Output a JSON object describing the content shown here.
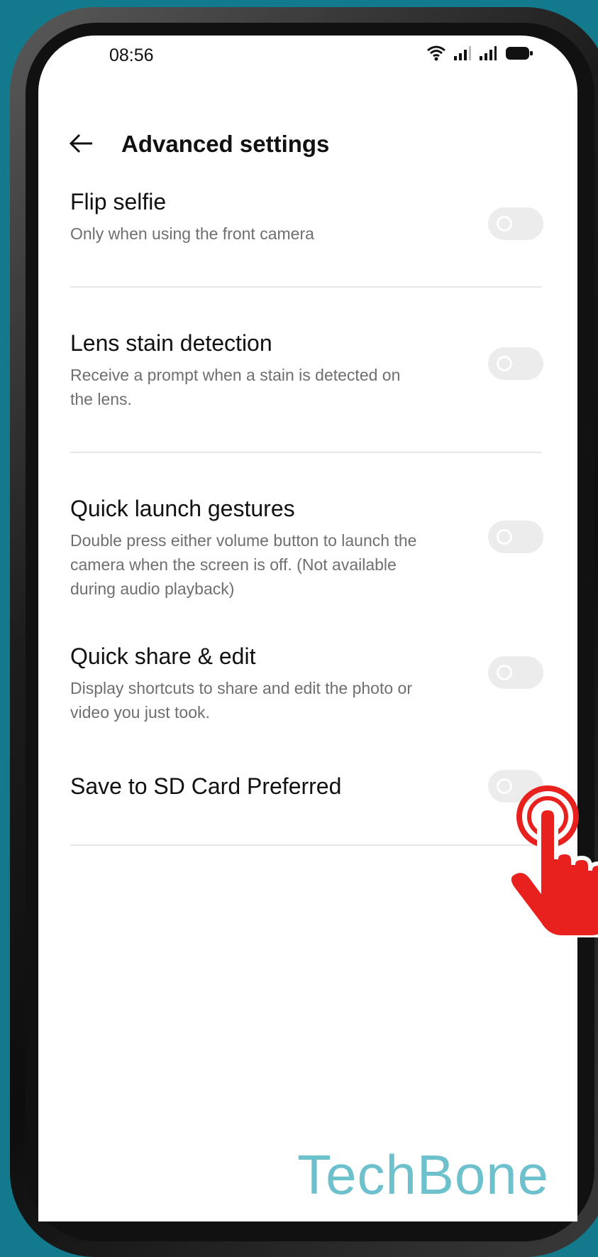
{
  "status_bar": {
    "time": "08:56",
    "icons": [
      "wifi-icon",
      "signal-icon",
      "signal-icon",
      "battery-icon"
    ]
  },
  "header": {
    "back_icon": "arrow-left-icon",
    "title": "Advanced settings"
  },
  "settings": [
    {
      "title": "Flip selfie",
      "description": "Only when using the front camera",
      "enabled": false
    },
    {
      "title": "Lens stain detection",
      "description": "Receive a prompt when a stain is detected on the lens.",
      "enabled": false
    },
    {
      "title": "Quick launch gestures",
      "description": "Double press either volume button to launch the camera when the screen is off. (Not available during audio playback)",
      "enabled": false
    },
    {
      "title": "Quick share & edit",
      "description": "Display shortcuts to share and edit the photo or video you just took.",
      "enabled": false
    },
    {
      "title": "Save to SD Card Preferred",
      "description": "",
      "enabled": false
    }
  ],
  "watermark": "TechBone",
  "colors": {
    "background": "#127a8c",
    "toggle_off": "#ececec",
    "pointer_hand": "#e8211f",
    "watermark": "#6cc1cc"
  }
}
